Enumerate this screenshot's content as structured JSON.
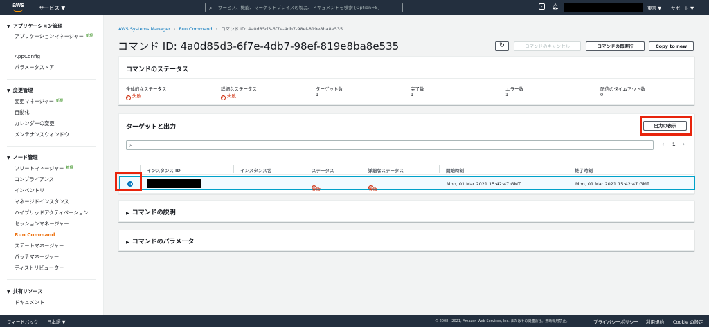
{
  "topbar": {
    "logo": "aws",
    "services_label": "サービス ▼",
    "search_placeholder": "サービス、機能、マーケットプレイスの製品、ドキュメントを検索 [Option+S]",
    "region": "東京 ▼",
    "support": "サポート ▼",
    "icons": [
      "search-icon",
      "terminal-icon",
      "bell-icon"
    ]
  },
  "sidebar": {
    "sections": [
      {
        "title": "アプリケーション管理",
        "items": [
          {
            "label": "アプリケーションマネージャー",
            "badge": "新規"
          },
          {
            "label": "AppConfig"
          },
          {
            "label": "パラメータストア"
          }
        ]
      },
      {
        "title": "変更管理",
        "items": [
          {
            "label": "変更マネージャー",
            "badge": "新規"
          },
          {
            "label": "自動化"
          },
          {
            "label": "カレンダーの変更"
          },
          {
            "label": "メンテナンスウィンドウ"
          }
        ]
      },
      {
        "title": "ノード管理",
        "items": [
          {
            "label": "フリートマネージャー",
            "badge": "新規"
          },
          {
            "label": "コンプライアンス"
          },
          {
            "label": "インベントリ"
          },
          {
            "label": "マネージドインスタンス"
          },
          {
            "label": "ハイブリッドアクティベーション"
          },
          {
            "label": "セッションマネージャー"
          },
          {
            "label": "Run Command",
            "active": true
          },
          {
            "label": "ステートマネージャー"
          },
          {
            "label": "パッチマネージャー"
          },
          {
            "label": "ディストリビューター"
          }
        ]
      },
      {
        "title": "共有リソース",
        "items": [
          {
            "label": "ドキュメント"
          }
        ]
      }
    ]
  },
  "breadcrumb": {
    "root": "AWS Systems Manager",
    "section": "Run Command",
    "current": "コマンド ID: 4a0d85d3-6f7e-4db7-98ef-819e8ba8e535"
  },
  "page_title": "コマンド ID: 4a0d85d3-6f7e-4db7-98ef-819e8ba8e535",
  "actions": {
    "refresh": "↻",
    "cancel": "コマンドのキャンセル",
    "rerun": "コマンドの再実行",
    "copy": "Copy to new"
  },
  "status_panel": {
    "title": "コマンドのステータス",
    "fields": [
      {
        "label": "全体的なステータス",
        "value": "失敗",
        "failed": true
      },
      {
        "label": "詳細なステータス",
        "value": "失敗",
        "failed": true
      },
      {
        "label": "ターゲット数",
        "value": "1"
      },
      {
        "label": "完了数",
        "value": "1"
      },
      {
        "label": "エラー数",
        "value": "1"
      },
      {
        "label": "配信のタイムアウト数",
        "value": "0"
      }
    ]
  },
  "targets_panel": {
    "title": "ターゲットと出力",
    "show_output": "出力の表示",
    "page": "1",
    "columns": [
      "インスタンス ID",
      "インスタンス名",
      "ステータス",
      "詳細なステータス",
      "開始時刻",
      "終了時刻"
    ],
    "row": {
      "instance_name": "",
      "status": "失敗",
      "detailed_status": "失敗",
      "start": "Mon, 01 Mar 2021 15:42:47 GMT",
      "end": "Mon, 01 Mar 2021 15:42:47 GMT"
    }
  },
  "description_panel": {
    "title": "コマンドの説明"
  },
  "params_panel": {
    "title": "コマンドのパラメータ"
  },
  "footer": {
    "feedback": "フィードバック",
    "language": "日本語 ▼",
    "copyright": "© 2008 - 2021, Amazon Web Services, Inc. またはその関連会社。無断転用禁止。",
    "privacy": "プライバシーポリシー",
    "terms": "利用規約",
    "cookie": "Cookie の設定"
  }
}
